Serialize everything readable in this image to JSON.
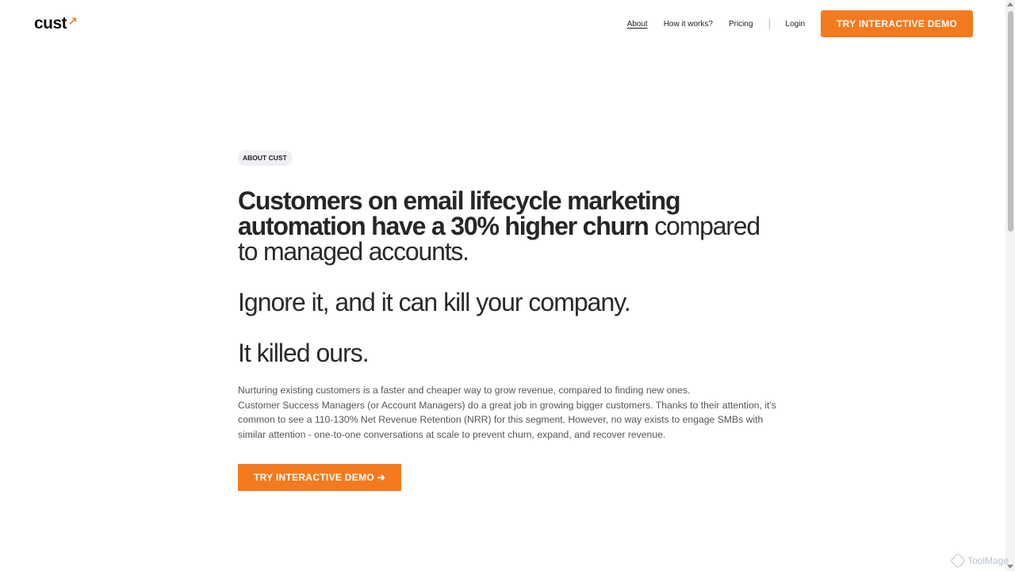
{
  "header": {
    "logo_text": "cust",
    "logo_mark": "↗",
    "nav": {
      "about": "About",
      "how": "How it works?",
      "pricing": "Pricing",
      "login": "Login",
      "demo": "TRY INTERACTIVE DEMO"
    }
  },
  "hero": {
    "badge": "ABOUT CUST",
    "headline_bold": "Customers on email lifecycle marketing automation have a 30% higher churn",
    "headline_rest": " compared to managed accounts.",
    "line2": "Ignore it, and it can kill your company.",
    "line3": "It killed ours.",
    "paragraph_1": "Nurturing existing customers is a faster and cheaper way to grow revenue, compared to finding new ones.",
    "paragraph_2": "Customer Success Managers (or Account Managers) do a great job in growing bigger customers. Thanks to their attention, it's common to see a 110-130% Net Revenue Retention (NRR) for this segment. However, no way exists to engage SMBs with similar attention - one-to-one conversations at scale to prevent churn, expand, and recover revenue.",
    "cta": "TRY INTERACTIVE DEMO ➔"
  },
  "watermark": "ToolMage",
  "colors": {
    "accent": "#f47a1f",
    "badge_bg": "#eef0f5",
    "text": "#2a2a2a",
    "body": "#555555"
  }
}
